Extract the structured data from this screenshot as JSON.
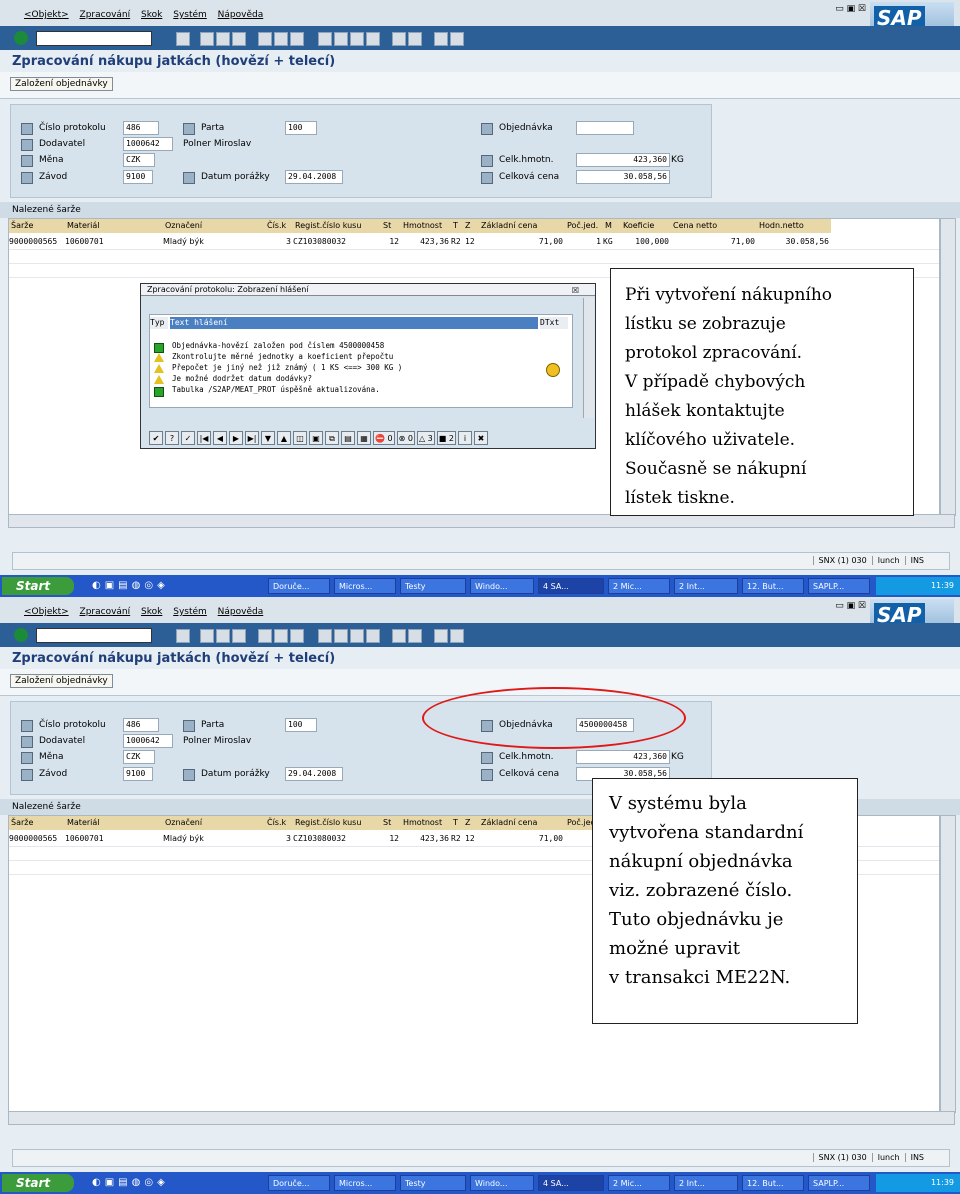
{
  "menu": [
    "<Objekt>",
    "Zpracování",
    "Skok",
    "Systém",
    "Nápověda"
  ],
  "window_controls": "▭ ▣ ☒",
  "logo": "SAP",
  "title": "Zpracování nákupu jatkách (hovězí + telecí)",
  "button": "Založení objednávky",
  "header_fields": {
    "cislo_protokolu_label": "Číslo protokolu",
    "cislo_protokolu": "486",
    "dodavatel_label": "Dodavatel",
    "dodavatel": "1000642",
    "mena_label": "Měna",
    "mena": "CZK",
    "zavod_label": "Závod",
    "zavod": "9100",
    "partie_label": "Parta",
    "partie": "100",
    "partner_name": "Polner Miroslav",
    "datum_label": "Datum porážky",
    "datum": "29.04.2008",
    "objednavka_label": "Objednávka",
    "objednavka_empty": "",
    "objednavka_filled": "4500000458",
    "celk_hmotn_label": "Celk.hmotn.",
    "celk_hmotn": "423,360",
    "celk_hmotn_unit": "KG",
    "celk_cena_label": "Celková cena",
    "celk_cena": "30.058,56"
  },
  "grid": {
    "title": "Nalezené šarže",
    "columns": [
      "Šarže",
      "Materiál",
      "Označení",
      "Čís.k",
      "Regist.číslo kusu",
      "St",
      "Hmotnost",
      "T",
      "Z",
      "Základní cena",
      "Poč.jed.",
      "M",
      "Koeficie",
      "Cena netto",
      "Hodn.netto"
    ],
    "row": [
      "9000000565",
      "10600701",
      "Mladý býk",
      "3",
      "CZ103080032",
      "12",
      "423,36",
      "R2",
      "12",
      "71,00",
      "1",
      "KG",
      "100,000",
      "71,00",
      "30.058,56"
    ]
  },
  "dialog": {
    "title": "Zpracování protokolu: Zobrazení hlášení",
    "col_typ": "Typ",
    "col_text": "Text hlášení",
    "col_dtxt": "DTxt",
    "messages": [
      {
        "type": "ok",
        "text": "Objednávka-hovězí založen pod číslem 4500000458"
      },
      {
        "type": "warn",
        "text": "Zkontrolujte měrné jednotky a koeficient přepočtu"
      },
      {
        "type": "warn",
        "text": "Přepočet je jiný než již známý  ( 1 KS <==> 300 KG )"
      },
      {
        "type": "warn",
        "text": "Je možné dodržet datum dodávky?"
      },
      {
        "type": "ok",
        "text": "Tabulka /S2AP/MEAT_PROT úspěšně aktualizována."
      }
    ],
    "toolbar": [
      "✔",
      "?",
      "✓",
      "|◀",
      "◀",
      "▶",
      "▶|",
      "▼",
      "▲",
      "◫",
      "▣",
      "⧉",
      "▤",
      "▦",
      "⛔ 0",
      "⊗ 0",
      "△ 3",
      "■ 2",
      "i",
      "✖"
    ]
  },
  "status": {
    "system": "SNX (1) 030",
    "client": "lunch",
    "mode": "INS"
  },
  "taskbar": {
    "start": "Start",
    "tasks": [
      "Doruče...",
      "Micros...",
      "Testy",
      "Windo...",
      "4 SA...",
      "2 Mic...",
      "2 Int...",
      "12. But...",
      "SAPLP..."
    ],
    "clock": "11:39"
  },
  "note1": [
    "Při vytvoření nákupního",
    "lístku se zobrazuje",
    "protokol zpracování.",
    "V případě chybových",
    "hlášek kontaktujte",
    "klíčového uživatele.",
    "Současně se nákupní",
    "lístek tiskne."
  ],
  "note2": [
    "V systému byla",
    "vytvořena standardní",
    "nákupní objednávka",
    "viz. zobrazené číslo.",
    "Tuto objednávku je",
    "možné upravit",
    "v transakci ME22N."
  ]
}
